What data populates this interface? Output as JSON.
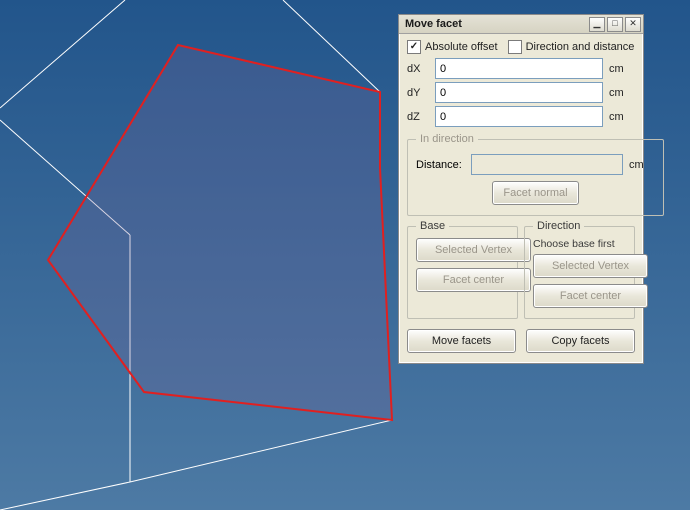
{
  "dialog": {
    "title": "Move facet",
    "absolute_offset": {
      "label": "Absolute offset",
      "checked": true
    },
    "direction_distance": {
      "label": "Direction and distance",
      "checked": false
    },
    "fields": {
      "dx": {
        "label": "dX",
        "value": "0",
        "unit": "cm"
      },
      "dy": {
        "label": "dY",
        "value": "0",
        "unit": "cm"
      },
      "dz": {
        "label": "dZ",
        "value": "0",
        "unit": "cm"
      }
    },
    "in_direction": {
      "legend": "In direction",
      "distance_label": "Distance:",
      "distance_value": "",
      "distance_unit": "cm",
      "facet_normal": "Facet normal"
    },
    "base": {
      "legend": "Base",
      "selected_vertex": "Selected Vertex",
      "facet_center": "Facet center"
    },
    "direction": {
      "legend": "Direction",
      "note": "Choose base first",
      "selected_vertex": "Selected Vertex",
      "facet_center": "Facet center"
    },
    "move_facets": "Move facets",
    "copy_facets": "Copy facets"
  }
}
